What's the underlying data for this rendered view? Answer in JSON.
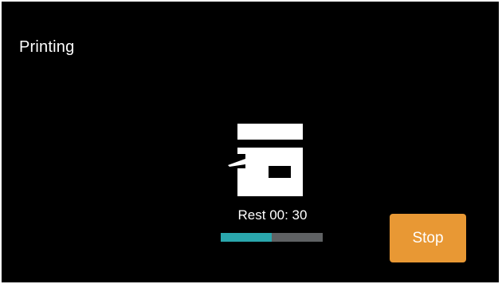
{
  "screen": {
    "title": "Printing"
  },
  "status": {
    "icon": "printer-icon",
    "rest_text": "Rest 00: 30",
    "progress": 0.5,
    "progress_color": "#2aa7ad",
    "track_color": "#5f6163"
  },
  "actions": {
    "stop_label": "Stop",
    "stop_color": "#e89834"
  }
}
